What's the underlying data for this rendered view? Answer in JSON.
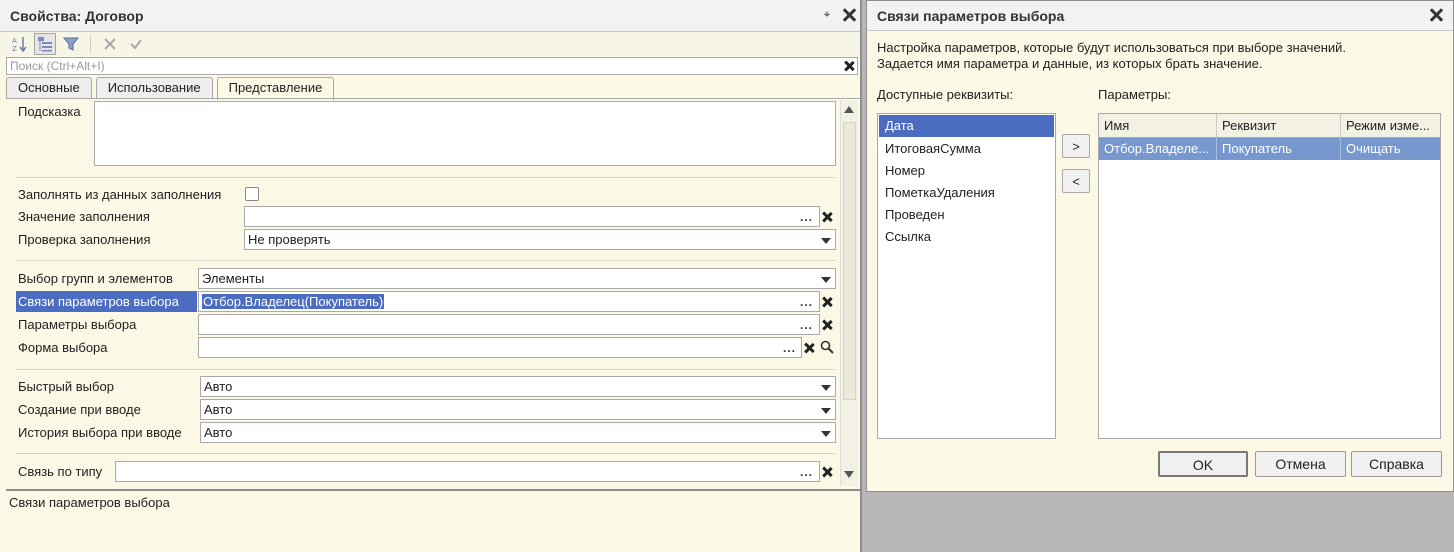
{
  "left_window": {
    "title": "Свойства: Договор",
    "pin_glyph": "⌖",
    "search_placeholder": "Поиск (Ctrl+Alt+I)",
    "tabs": [
      {
        "label": "Основные"
      },
      {
        "label": "Использование"
      },
      {
        "label": "Представление",
        "active": true
      }
    ],
    "hint": {
      "label": "Подсказка",
      "value": ""
    },
    "fill_from_data": {
      "label": "Заполнять из данных заполнения",
      "checked": false
    },
    "fill_value": {
      "label": "Значение заполнения",
      "value": ""
    },
    "fill_check": {
      "label": "Проверка заполнения",
      "value": "Не проверять"
    },
    "group_selection": {
      "label": "Выбор групп и элементов",
      "value": "Элементы"
    },
    "param_links": {
      "label": "Связи параметров выбора",
      "value": "Отбор.Владелец(Покупатель)"
    },
    "choice_params": {
      "label": "Параметры выбора",
      "value": ""
    },
    "choice_form": {
      "label": "Форма выбора",
      "value": ""
    },
    "quick_choice": {
      "label": "Быстрый выбор",
      "value": "Авто"
    },
    "create_on_input": {
      "label": "Создание при вводе",
      "value": "Авто"
    },
    "history_on_input": {
      "label": "История выбора при вводе",
      "value": "Авто"
    },
    "link_by_type": {
      "label": "Связь по типу",
      "value": ""
    },
    "description": "Связи параметров выбора"
  },
  "dialog": {
    "title": "Связи параметров выбора",
    "intro_line1": "Настройка параметров, которые будут использоваться при выборе значений.",
    "intro_line2": "Задается имя параметра и данные, из которых брать значение.",
    "available_label": "Доступные реквизиты:",
    "params_label": "Параметры:",
    "available_items": [
      "Дата",
      "ИтоговаяСумма",
      "Номер",
      "ПометкаУдаления",
      "Проведен",
      "Ссылка"
    ],
    "add_button": ">",
    "remove_button": "<",
    "columns": [
      "Имя",
      "Реквизит",
      "Режим изме..."
    ],
    "rows": [
      [
        "Отбор.Владеле...",
        "Покупатель",
        "Очищать"
      ]
    ],
    "ok_label": "OK",
    "cancel_label": "Отмена",
    "help_label": "Справка"
  },
  "colors": {
    "selection": "#4b6cc0",
    "grid_selection": "#7698cf",
    "window_bg": "#fbf8e6"
  }
}
